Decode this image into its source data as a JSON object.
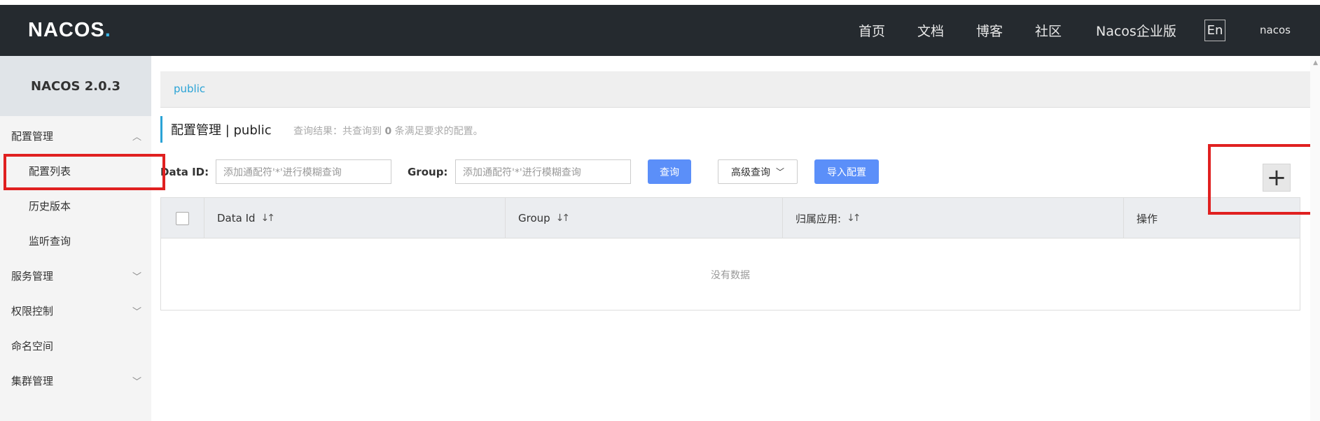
{
  "header": {
    "logo": "NACOS",
    "logo_dot": ".",
    "nav": [
      "首页",
      "文档",
      "博客",
      "社区",
      "Nacos企业版"
    ],
    "lang": "En",
    "user": "nacos"
  },
  "sidebar": {
    "title": "NACOS 2.0.3",
    "items": [
      {
        "label": "配置管理",
        "chevron": "^"
      },
      {
        "label": "配置列表"
      },
      {
        "label": "历史版本"
      },
      {
        "label": "监听查询"
      },
      {
        "label": "服务管理",
        "chevron": "v"
      },
      {
        "label": "权限控制",
        "chevron": "v"
      },
      {
        "label": "命名空间"
      },
      {
        "label": "集群管理",
        "chevron": "v"
      }
    ]
  },
  "main": {
    "namespace_link": "public",
    "heading": "配置管理  |  public",
    "query_result_prefix": "查询结果：共查询到",
    "query_result_count": "0",
    "query_result_suffix": "条满足要求的配置。",
    "filters": {
      "data_id_label": "Data ID:",
      "data_id_placeholder": "添加通配符'*'进行模糊查询",
      "group_label": "Group:",
      "group_placeholder": "添加通配符'*'进行模糊查询"
    },
    "buttons": {
      "query": "查询",
      "advanced": "高级查询",
      "import": "导入配置",
      "add": "+"
    },
    "table": {
      "columns": [
        "Data Id",
        "Group",
        "归属应用:",
        "操作"
      ],
      "empty_text": "没有数据"
    }
  },
  "colors": {
    "header_bg": "#252a2f",
    "accent": "#2aa3d6",
    "primary_button": "#5b8ff9",
    "highlight": "#e02020"
  }
}
